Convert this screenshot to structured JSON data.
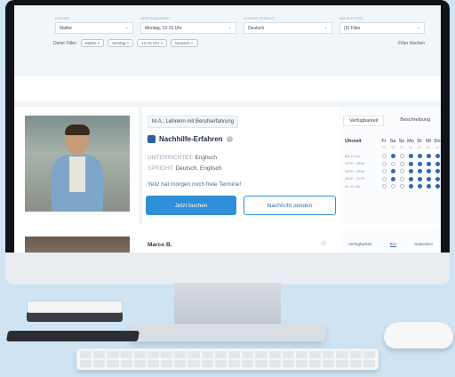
{
  "filters": {
    "subject": {
      "label": "FACHER",
      "value": "Mathe"
    },
    "availability": {
      "label": "VERFÜGBARKEIT",
      "value": "Montag, 12-15 Uhr"
    },
    "language": {
      "label": "LEHRER SPRICHT",
      "value": "Deutsch"
    },
    "more": {
      "label": "MEHR FILTER",
      "value": "(3) Filter"
    },
    "active_label": "Deine Filter:",
    "chips": [
      "Mathe ×",
      "Montag ×",
      "12-15 Uhr ×",
      "Deutsch ×"
    ],
    "clear_label": "Filter löschen"
  },
  "teacher": {
    "tag": "M.A., Lehrerin mit Berufserfahrung",
    "headline": "Nachhilfe-Erfahren",
    "teaches_key": "UNTERRICHTET:",
    "teaches_value": "Englisch",
    "speaks_key": "SPRICHT:",
    "speaks_value": "Deutsch, Englisch",
    "notice": "Yeliz hat morgen noch freie Termine!",
    "book_label": "Jetzt buchen",
    "message_label": "Nachricht senden"
  },
  "availability": {
    "tabs": [
      "Verfügbarkeit",
      "Beschreibung"
    ],
    "time_header": "Uhrzeit",
    "days": [
      "Fr",
      "Sa",
      "So",
      "Mo",
      "Di",
      "Mi",
      "Do"
    ],
    "dates": [
      "29",
      "30",
      "31",
      "01",
      "02",
      "03",
      "04"
    ],
    "slots": [
      {
        "label": "Bis 12 Uhr",
        "avail": [
          0,
          1,
          0,
          1,
          1,
          1,
          1
        ]
      },
      {
        "label": "12:00 - 15:00",
        "avail": [
          0,
          0,
          0,
          1,
          1,
          1,
          1
        ]
      },
      {
        "label": "15:00 - 18:00",
        "avail": [
          0,
          1,
          0,
          1,
          1,
          1,
          1
        ]
      },
      {
        "label": "18:00 - 21:00",
        "avail": [
          0,
          1,
          0,
          1,
          1,
          1,
          1
        ]
      },
      {
        "label": "Ab 21 Uhr",
        "avail": [
          0,
          0,
          0,
          1,
          1,
          1,
          1
        ]
      }
    ]
  },
  "teacher2": {
    "name": "Marco B.",
    "tabs": [
      "Verfügbarkeit",
      "Bes",
      "Statistiken"
    ]
  },
  "colors": {
    "accent": "#2e8fd6",
    "available": "#2f66b3"
  }
}
